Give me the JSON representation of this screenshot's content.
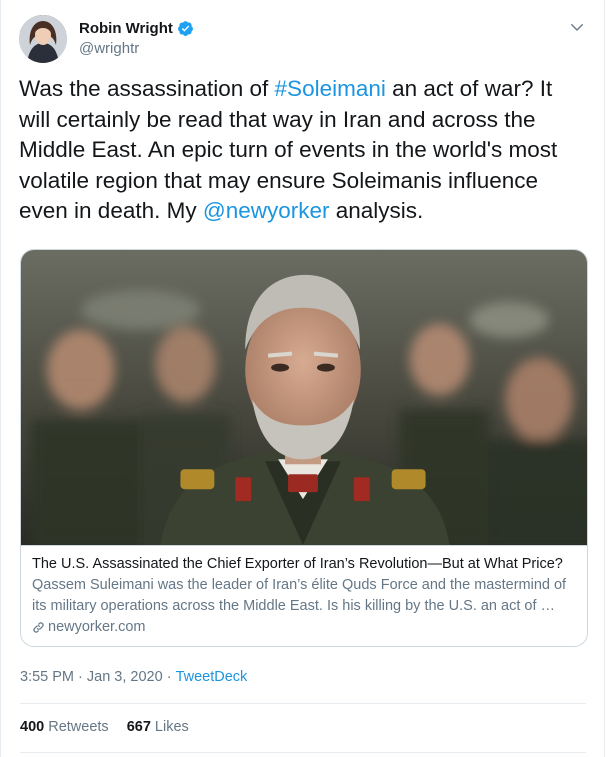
{
  "author": {
    "name": "Robin Wright",
    "handle": "@wrightr",
    "verified": true
  },
  "tweet": {
    "segments": [
      {
        "text": "Was the assassination of ",
        "type": "text"
      },
      {
        "text": "#Soleimani",
        "type": "hashtag"
      },
      {
        "text": " an act of war? It will certainly be read that way in Iran and across the Middle East. An epic turn of events in the world's most volatile region that may ensure Soleimanis influence even in death. My ",
        "type": "text"
      },
      {
        "text": "@newyorker",
        "type": "mention"
      },
      {
        "text": " analysis.",
        "type": "text"
      }
    ]
  },
  "card": {
    "title": "The U.S. Assassinated the Chief Exporter of Iran’s Revolution—But at What Price?",
    "description": "Qassem Suleimani was the leader of Iran’s élite Quds Force and the mastermind of its military operations across the Middle East. Is his killing by the U.S. an act of …",
    "domain": "newyorker.com"
  },
  "meta": {
    "time": "3:55 PM",
    "separator1": " · ",
    "date": "Jan 3, 2020",
    "separator2": " · ",
    "source": "TweetDeck"
  },
  "stats": {
    "retweets_count": "400",
    "retweets_label": " Retweets",
    "likes_count": "667",
    "likes_label": " Likes"
  },
  "icons": {
    "verified": "verified-badge-icon",
    "more": "chevron-down-icon",
    "link": "link-icon"
  },
  "colors": {
    "link": "#1b95e0",
    "secondary_text": "#657786",
    "primary_text": "#14171a",
    "border": "#ccd6dd",
    "verified": "#1da1f2"
  }
}
